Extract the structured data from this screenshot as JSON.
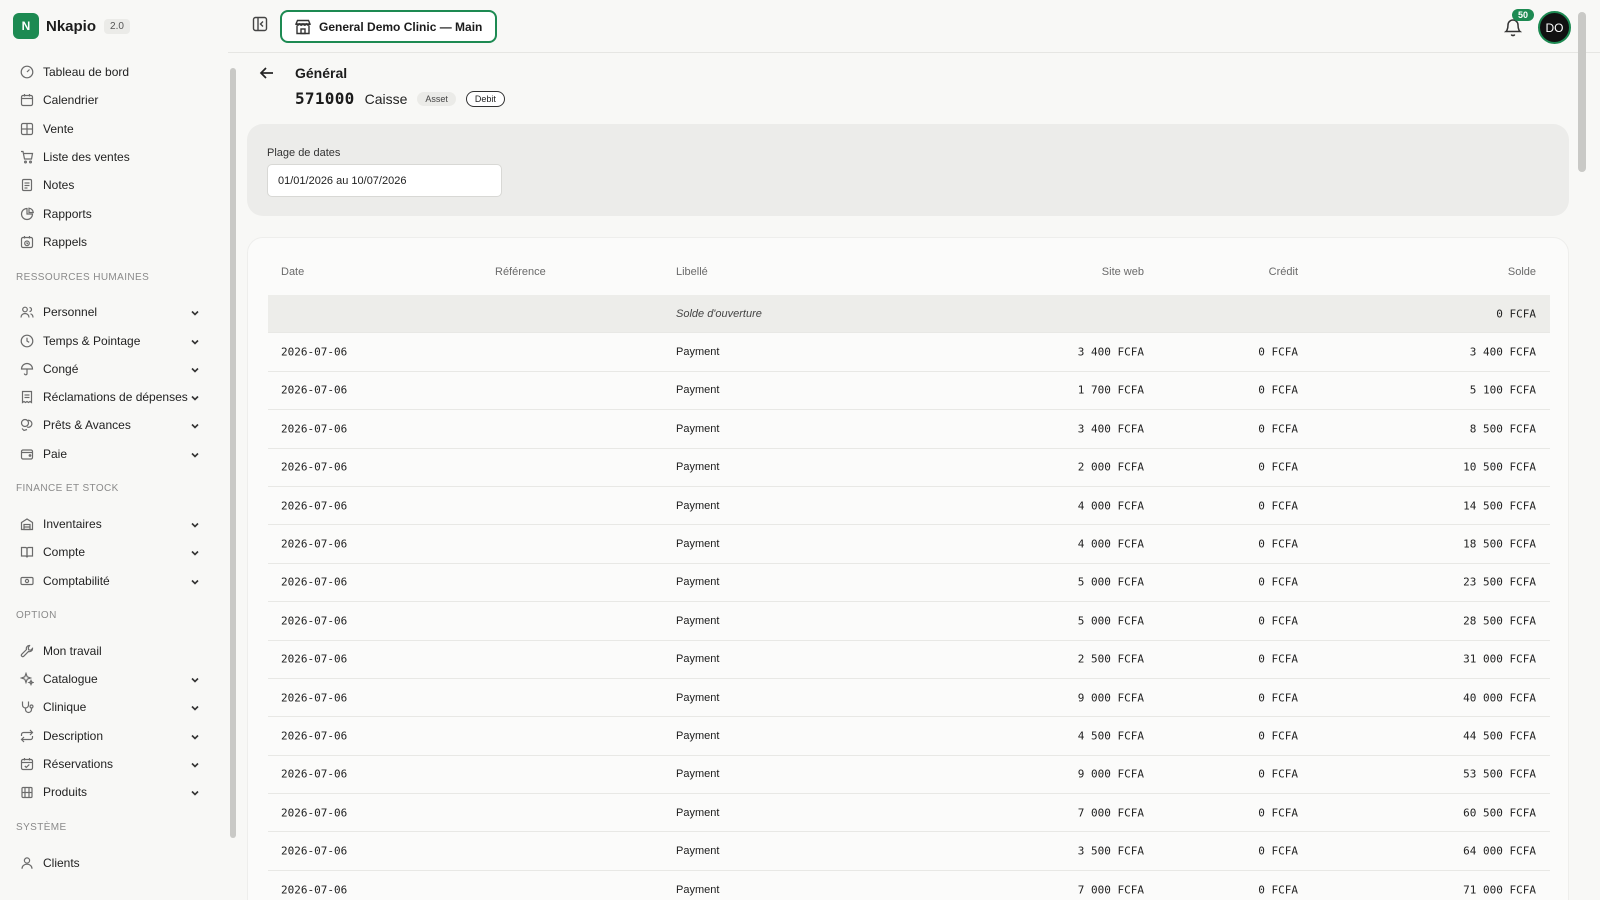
{
  "app": {
    "name": "Nkapio",
    "version": "2.0",
    "logo_letter": "N"
  },
  "colors": {
    "accent": "#1d8a52",
    "background": "#f8f8f6"
  },
  "sidebar": {
    "top_items": [
      {
        "label": "Tableau de bord",
        "icon": "gauge-icon"
      },
      {
        "label": "Calendrier",
        "icon": "calendar-icon"
      },
      {
        "label": "Vente",
        "icon": "grid-icon"
      },
      {
        "label": "Liste des ventes",
        "icon": "cart-icon"
      },
      {
        "label": "Notes",
        "icon": "note-icon"
      },
      {
        "label": "Rapports",
        "icon": "pie-chart-icon"
      },
      {
        "label": "Rappels",
        "icon": "calendar-clock-icon"
      }
    ],
    "sections": [
      {
        "title": "RESSOURCES HUMAINES",
        "items": [
          {
            "label": "Personnel",
            "icon": "users-icon"
          },
          {
            "label": "Temps & Pointage",
            "icon": "clock-icon"
          },
          {
            "label": "Congé",
            "icon": "umbrella-icon"
          },
          {
            "label": "Réclamations de dépenses",
            "icon": "receipt-icon"
          },
          {
            "label": "Prêts & Avances",
            "icon": "coins-icon"
          },
          {
            "label": "Paie",
            "icon": "wallet-icon"
          }
        ]
      },
      {
        "title": "FINANCE ET STOCK",
        "items": [
          {
            "label": "Inventaires",
            "icon": "warehouse-icon"
          },
          {
            "label": "Compte",
            "icon": "book-icon"
          },
          {
            "label": "Comptabilité",
            "icon": "cash-icon"
          }
        ]
      },
      {
        "title": "OPTION",
        "items": [
          {
            "label": "Mon travail",
            "icon": "wrench-icon",
            "no_chevron": true
          },
          {
            "label": "Catalogue",
            "icon": "sparkles-icon"
          },
          {
            "label": "Clinique",
            "icon": "stethoscope-icon"
          },
          {
            "label": "Description",
            "icon": "repeat-icon"
          },
          {
            "label": "Réservations",
            "icon": "calendar-check-icon"
          },
          {
            "label": "Produits",
            "icon": "building-icon"
          }
        ]
      },
      {
        "title": "SYSTÈME",
        "items": [
          {
            "label": "Clients",
            "icon": "user-icon",
            "no_chevron": true
          }
        ]
      }
    ]
  },
  "topbar": {
    "clinic_label": "General Demo Clinic — Main",
    "notification_count": "50",
    "avatar_initials": "DO"
  },
  "account": {
    "title": "Général",
    "code": "571000",
    "name": "Caisse",
    "type_tag": "Asset",
    "balance_tag": "Debit"
  },
  "filter": {
    "label": "Plage de dates",
    "value": "01/01/2026 au 10/07/2026"
  },
  "table": {
    "headers": {
      "date": "Date",
      "reference": "Référence",
      "label": "Libellé",
      "web": "Site web",
      "credit": "Crédit",
      "balance": "Solde"
    },
    "opening": {
      "label": "Solde d'ouverture",
      "balance": "0 FCFA"
    },
    "rows": [
      {
        "date": "2026-07-06",
        "ref": "",
        "label": "Payment",
        "web": "3 400 FCFA",
        "credit": "0 FCFA",
        "balance": "3 400 FCFA"
      },
      {
        "date": "2026-07-06",
        "ref": "",
        "label": "Payment",
        "web": "1 700 FCFA",
        "credit": "0 FCFA",
        "balance": "5 100 FCFA"
      },
      {
        "date": "2026-07-06",
        "ref": "",
        "label": "Payment",
        "web": "3 400 FCFA",
        "credit": "0 FCFA",
        "balance": "8 500 FCFA"
      },
      {
        "date": "2026-07-06",
        "ref": "",
        "label": "Payment",
        "web": "2 000 FCFA",
        "credit": "0 FCFA",
        "balance": "10 500 FCFA"
      },
      {
        "date": "2026-07-06",
        "ref": "",
        "label": "Payment",
        "web": "4 000 FCFA",
        "credit": "0 FCFA",
        "balance": "14 500 FCFA"
      },
      {
        "date": "2026-07-06",
        "ref": "",
        "label": "Payment",
        "web": "4 000 FCFA",
        "credit": "0 FCFA",
        "balance": "18 500 FCFA"
      },
      {
        "date": "2026-07-06",
        "ref": "",
        "label": "Payment",
        "web": "5 000 FCFA",
        "credit": "0 FCFA",
        "balance": "23 500 FCFA"
      },
      {
        "date": "2026-07-06",
        "ref": "",
        "label": "Payment",
        "web": "5 000 FCFA",
        "credit": "0 FCFA",
        "balance": "28 500 FCFA"
      },
      {
        "date": "2026-07-06",
        "ref": "",
        "label": "Payment",
        "web": "2 500 FCFA",
        "credit": "0 FCFA",
        "balance": "31 000 FCFA"
      },
      {
        "date": "2026-07-06",
        "ref": "",
        "label": "Payment",
        "web": "9 000 FCFA",
        "credit": "0 FCFA",
        "balance": "40 000 FCFA"
      },
      {
        "date": "2026-07-06",
        "ref": "",
        "label": "Payment",
        "web": "4 500 FCFA",
        "credit": "0 FCFA",
        "balance": "44 500 FCFA"
      },
      {
        "date": "2026-07-06",
        "ref": "",
        "label": "Payment",
        "web": "9 000 FCFA",
        "credit": "0 FCFA",
        "balance": "53 500 FCFA"
      },
      {
        "date": "2026-07-06",
        "ref": "",
        "label": "Payment",
        "web": "7 000 FCFA",
        "credit": "0 FCFA",
        "balance": "60 500 FCFA"
      },
      {
        "date": "2026-07-06",
        "ref": "",
        "label": "Payment",
        "web": "3 500 FCFA",
        "credit": "0 FCFA",
        "balance": "64 000 FCFA"
      },
      {
        "date": "2026-07-06",
        "ref": "",
        "label": "Payment",
        "web": "7 000 FCFA",
        "credit": "0 FCFA",
        "balance": "71 000 FCFA"
      }
    ]
  }
}
